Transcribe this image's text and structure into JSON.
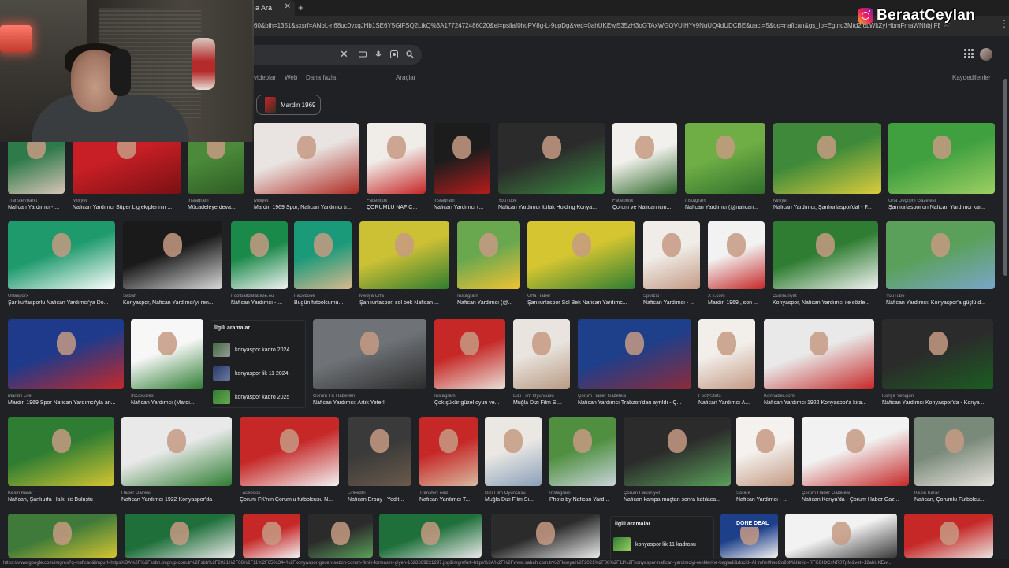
{
  "browser": {
    "tab_title": "a Ara",
    "url": "60&bih=1351&sxsrf=ANbL-n68uc0vxqJHb1SE6Y5GiFSQ2LikQ%3A1772472486020&ei=psilaf0hoPV8g-L-9upDg&ved=0ahUKEwj535zH3oGTAxWGQVUIHYv9NuUQ4dUDCBE&uact=5&oq=nafican&gs_lp=Egtnd3Mtd2l6LWltZyIHbmFmaWNhbjIFEAA"
  },
  "search": {
    "tabs": [
      "videolar",
      "Web",
      "Daha fazla",
      "Araçlar"
    ],
    "saved": "Kaydedilenler",
    "chip": "Mardin 1969"
  },
  "results": [
    {
      "src": "Transfermarkt",
      "title": "Nafican Yardımcı - ...",
      "c1": "#2e7a4a",
      "c2": "#d7c4b6"
    },
    {
      "src": "Milliyet",
      "title": "Nafican Yardımcı Süper Lig ekiplerinin ...",
      "c1": "#c71f25",
      "c2": "#7a1013"
    },
    {
      "src": "Instagram",
      "title": "Mücadeleye deva...",
      "c1": "#4b8a3a",
      "c2": "#2e5d25"
    },
    {
      "src": "Milliyet",
      "title": "Mardin 1969 Spor, Nafican Yardımcı tr...",
      "c1": "#e9e4e1",
      "c2": "#b02c25"
    },
    {
      "src": "Facebook",
      "title": "ÇORUMLU NAFİC...",
      "c1": "#f0ece8",
      "c2": "#c62828"
    },
    {
      "src": "Instagram",
      "title": "Nafican Yardımcı (...",
      "c1": "#1c1c1c",
      "c2": "#b71c1c"
    },
    {
      "src": "YouTube",
      "title": "Nafican Yardımcı İttifak Holding Konya...",
      "c1": "#2b2b2b",
      "c2": "#3b8a3f"
    },
    {
      "src": "Facebook",
      "title": "Çorum ve Nafican için...",
      "c1": "#f2f0ec",
      "c2": "#2f6a2b"
    },
    {
      "src": "Instagram",
      "title": "Nafican Yardımcı (@nafican...",
      "c1": "#6fae45",
      "c2": "#2f6f2b"
    },
    {
      "src": "Milliyet",
      "title": "Nafican Yardımcı, Şanlıurfaspor'dal - F...",
      "c1": "#3f8a3a",
      "c2": "#d9cc3d"
    },
    {
      "src": "Urfa Değişim Gazetesi",
      "title": "Şanlıurfaspor'un Nafican Yardımcı kar...",
      "c1": "#40a040",
      "c2": "#9dcf63"
    },
    {
      "src": "Urfasporx",
      "title": "Şanlıurfasporlu Nafican Yardımcı'ya Do...",
      "c1": "#1e9a6d",
      "c2": "#ffffff"
    },
    {
      "src": "Sabah",
      "title": "Konyaspor, Nafican Yardımcı'yı ren...",
      "c1": "#1a1a1a",
      "c2": "#d9d9d9"
    },
    {
      "src": "Footballdatabase.eu",
      "title": "Nafican Yardımcı - ...",
      "c1": "#1a8a4a",
      "c2": "#f2f2f2"
    },
    {
      "src": "Facebook",
      "title": "Bugün futbolcumu...",
      "c1": "#1b9a7a",
      "c2": "#d9b98f"
    },
    {
      "src": "Medya Urfa",
      "title": "Şanlıurfaspor, sol bek Nafican ...",
      "c1": "#ccc035",
      "c2": "#2f7c2f"
    },
    {
      "src": "Instagram",
      "title": "Nafican Yardımcı (@...",
      "c1": "#6aa84f",
      "c2": "#f1c232"
    },
    {
      "src": "Urfa Haber",
      "title": "Şanlıurfaspor Sol Bek Nafican Yardımc...",
      "c1": "#d4c531",
      "c2": "#2e7d32"
    },
    {
      "src": "Sporzip",
      "title": "Nafican Yardımcı - ...",
      "c1": "#f0ece8",
      "c2": "#c49a84"
    },
    {
      "src": "X x.com",
      "title": "Mardin 1969 , son ...",
      "c1": "#f2f2f2",
      "c2": "#c62828"
    },
    {
      "src": "Cumhuriyet",
      "title": "Konyaspor, Nafican Yardımcı ile sözle...",
      "c1": "#2f7d32",
      "c2": "#f2f2f2"
    },
    {
      "src": "YouTube",
      "title": "Nafican Yardımcı: Konyaspor'a güçlü d...",
      "c1": "#5aa05a",
      "c2": "#7aa6c8"
    },
    {
      "src": "Mardin Life",
      "title": "Mardin 1969 Spor Nafican Yardımcı'yla an...",
      "c1": "#1f3a8a",
      "c2": "#c62828"
    },
    {
      "src": "365Scores",
      "title": "Nafican Yardımcı (Mardi...",
      "c1": "#f7f7f7",
      "c2": "#2e7d32"
    },
    {
      "src": "Çorum FK Haberleri",
      "title": "Nafican Yardımcı: Artık Yeter!",
      "c1": "#6f7377",
      "c2": "#2b2b2b"
    },
    {
      "src": "Instagram",
      "title": "Çok şükür güzel oyun ve...",
      "c1": "#c62828",
      "c2": "#e9e0d6"
    },
    {
      "src": "Dizi Film Oyuncusu",
      "title": "Muğla Dizi Film Si...",
      "c1": "#e9e4df",
      "c2": "#b89a82"
    },
    {
      "src": "Çorum Haber Gazetesi",
      "title": "Nafican Yardımcı Trabzon'dan ayrıldı - Ç...",
      "c1": "#1e3f8a",
      "c2": "#8c2b3a"
    },
    {
      "src": "FootyStats",
      "title": "Nafican Yardımcı A...",
      "c1": "#f2eeea",
      "c2": "#c49a84"
    },
    {
      "src": "Konhaber.com",
      "title": "Nafican Yardımcı 1922 Konyaspor'a kira...",
      "c1": "#e9e9e9",
      "c2": "#c62828"
    },
    {
      "src": "Konya Yenigün",
      "title": "Nafican Yardımcı Konyaspor'da - Konya ...",
      "c1": "#2b2b2b",
      "c2": "#1b5e20"
    },
    {
      "src": "Kesin Karar",
      "title": "Nafican, Şanlıurfa Halkı ile Buluştu",
      "c1": "#2f7d32",
      "c2": "#d4c531"
    },
    {
      "src": "Haber Dairesi",
      "title": "Nafican Yardımcı 1922 Konyaspor'da",
      "c1": "#e9e9e9",
      "c2": "#2e7d32"
    },
    {
      "src": "Facebook",
      "title": "Çorum FK'nın Çorumlu futbolcusu N...",
      "c1": "#c62828",
      "c2": "#f2f2f2"
    },
    {
      "src": "LinkedIn",
      "title": "Nafican Erbay - Yedit...",
      "c1": "#3a3a3a",
      "c2": "#6a5a4a"
    },
    {
      "src": "TransferFeed",
      "title": "Nafican Yardımcı T...",
      "c1": "#c62828",
      "c2": "#d9b9a0"
    },
    {
      "src": "Dizi Film Oyuncusu",
      "title": "Muğla Dizi Film Si...",
      "c1": "#ebe8e4",
      "c2": "#8aa0b8"
    },
    {
      "src": "Instagram",
      "title": "Photo by Nafican Yard...",
      "c1": "#4f8f3f",
      "c2": "#c9d4da"
    },
    {
      "src": "Çorum Hakimiyet",
      "title": "Nafican kampa maçtan sonra katılaca...",
      "c1": "#2b2b2b",
      "c2": "#5aa05a"
    },
    {
      "src": "Sorare",
      "title": "Nafican Yardımcı - ...",
      "c1": "#f4f1ee",
      "c2": "#c49a84"
    },
    {
      "src": "Çorum Haber Gazetesi",
      "title": "Nafican Konya'da - Çorum Haber Gaz...",
      "c1": "#f2f2f2",
      "c2": "#c62828"
    },
    {
      "src": "Kesin Karar",
      "title": "Nafican, Çorumlu Futbolcu...",
      "c1": "#7a8a7a",
      "c2": "#e9e4df"
    },
    {
      "src": "",
      "title": "",
      "c1": "#3f7a3a",
      "c2": "#d4c531"
    },
    {
      "src": "",
      "title": "",
      "c1": "#1e6f3a",
      "c2": "#e9e9e9"
    },
    {
      "src": "",
      "title": "",
      "c1": "#c62828",
      "c2": "#f2f2f2"
    },
    {
      "src": "",
      "title": "",
      "c1": "#2b2b2b",
      "c2": "#5aa05a"
    },
    {
      "src": "",
      "title": "",
      "c1": "#1e6f3a",
      "c2": "#e9e9e9"
    },
    {
      "src": "",
      "title": "",
      "c1": "#2b2b2b",
      "c2": "#e9e9e9"
    },
    {
      "src": "",
      "title": "",
      "c1": "#1e3f8a",
      "c2": "#f2f2f2"
    },
    {
      "src": "",
      "title": "",
      "c1": "#f2f2f2",
      "c2": "#3a3a3a"
    },
    {
      "src": "",
      "title": "",
      "c1": "#c62828",
      "c2": "#e9e4df"
    }
  ],
  "related_1": {
    "heading": "İlgili aramalar",
    "items": [
      "konyaspor kadro 2024",
      "konyaspor lik 11 2024",
      "konyaspor kadro 2025"
    ]
  },
  "related_2": {
    "heading": "İlgili aramalar",
    "items": [
      "konyaspor lik 11 kadrosu"
    ]
  },
  "done_deal_text": "DONE DEAL",
  "brand": {
    "name": "BeraatCeylan"
  },
  "statusbar": "https://www.google.com/imgres?q=nafican&imgurl=https%3A%2F%2Fssbh.tmgrup.com.tr%2Fsbh%2F2021%2F08%2F11%2F650x344%2Fkonyaspor-gecen-sezon-corum-fknin-formasini-giyen-1628669221297.jpg&imgrefurl=https%3A%2F%2Fwww.sabah.com.tr%2Fkonya%2F2021%2F08%2F11%2Fkonyaspor-nafican-yardimciyi-renklerine-bagladi&docid=AHmfm0hsoCo9pM&tbnid=RTKCIOCsNR0TpM&vet=12ahUKEwj..."
}
